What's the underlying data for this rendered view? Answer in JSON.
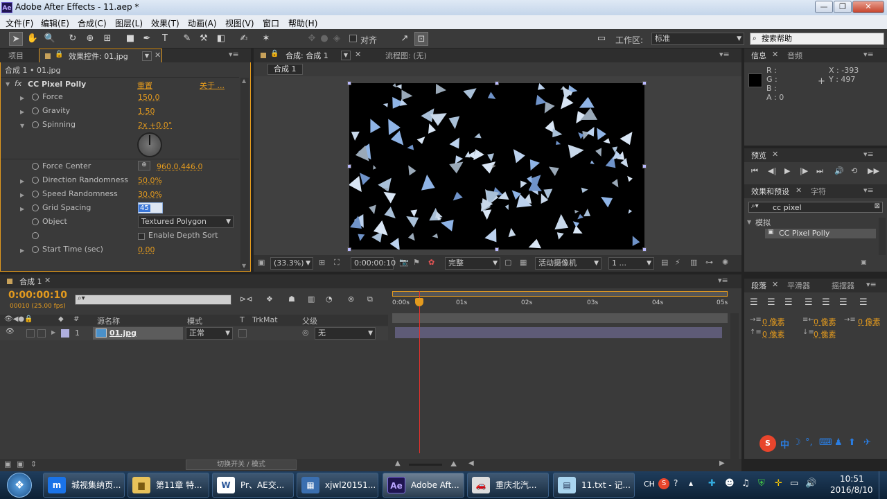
{
  "window": {
    "title": "Adobe After Effects - 11.aep *",
    "logo": "Ae"
  },
  "menu": [
    "文件(F)",
    "编辑(E)",
    "合成(C)",
    "图层(L)",
    "效果(T)",
    "动画(A)",
    "视图(V)",
    "窗口",
    "帮助(H)"
  ],
  "toolbar": {
    "align_label": "对齐",
    "workspace_label": "工作区:",
    "workspace_value": "标准",
    "search_placeholder": "搜索帮助"
  },
  "project_panel": {
    "tab_project": "项目",
    "tab_effects": "效果控件: 01.jpg",
    "breadcrumb": "合成 1 • 01.jpg",
    "effect_name": "CC Pixel Polly",
    "reset": "重置",
    "about": "关于 ...",
    "params": [
      {
        "name": "Force",
        "value": "150.0"
      },
      {
        "name": "Gravity",
        "value": "1.50"
      },
      {
        "name": "Spinning",
        "value": "2x +0.0°"
      },
      {
        "name": "Force Center",
        "value": "960.0,446.0"
      },
      {
        "name": "Direction Randomness",
        "value": "50.0%"
      },
      {
        "name": "Speed Randomness",
        "value": "30.0%"
      },
      {
        "name": "Grid Spacing",
        "value": "45"
      },
      {
        "name": "Object",
        "value": "Textured Polygon"
      },
      {
        "name": "Enable Depth Sort",
        "value": ""
      },
      {
        "name": "Start Time (sec)",
        "value": "0.00"
      }
    ]
  },
  "comp_panel": {
    "tab_comp": "合成: 合成 1",
    "tab_flow": "流程图: (无)",
    "comp_button": "合成 1",
    "zoom": "(33.3%)",
    "timecode": "0:00:00:10",
    "quality": "完整",
    "camera": "活动摄像机",
    "views": "1 ..."
  },
  "info_panel": {
    "tab_info": "信息",
    "tab_audio": "音频",
    "r": "R :",
    "g": "G :",
    "b": "B :",
    "a": "A : 0",
    "x": "X : -393",
    "y": "Y : 497"
  },
  "preview_panel": {
    "tab": "预览"
  },
  "effects_presets": {
    "tab": "效果和预设",
    "tab_char": "字符",
    "search": "cc pixel",
    "folder": "模拟",
    "item": "CC Pixel Polly"
  },
  "paragraph_panel": {
    "tab": "段落",
    "tab_smoother": "平滑器",
    "tab_wiggler": "摇摆器",
    "units": [
      "0 像素",
      "0 像素",
      "0 像素",
      "0 像素",
      "0 像素"
    ]
  },
  "timeline": {
    "tab": "合成 1",
    "timecode": "0:00:00:10",
    "frames": "00010 (25.00 fps)",
    "col_source": "源名称",
    "col_mode": "模式",
    "col_t": "T",
    "col_trkmat": "TrkMat",
    "col_parent": "父级",
    "layer_num": "1",
    "layer_name": "01.jpg",
    "layer_mode": "正常",
    "layer_parent": "无",
    "ruler": [
      "0:00s",
      "01s",
      "02s",
      "03s",
      "04s",
      "05s"
    ],
    "playhead_fraction": 0.08,
    "toggle_label": "切换开关 / 模式"
  },
  "taskbar": {
    "items": [
      "城视集纳页...",
      "第11章 特...",
      "Pr、AE交...",
      "xjwl20151...",
      "Adobe Aft...",
      "重庆北汽...",
      "11.txt - 记..."
    ],
    "lang": "CH",
    "time": "10:51",
    "date": "2016/8/10"
  }
}
